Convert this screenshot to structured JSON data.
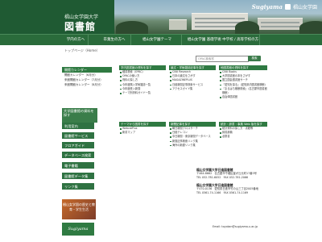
{
  "header": {
    "subtitle": "椙山女学園大学",
    "title": "図書館",
    "brand": "Sugiyama",
    "brand_sub": "椙山女学園"
  },
  "nav": {
    "items": [
      {
        "label": "学内の方へ"
      },
      {
        "label": "卒業生の方へ"
      },
      {
        "label": "椙山女学園テーマ"
      },
      {
        "label": "椙山女学園 基礎学術 中学校 / 高等学校の方へ"
      }
    ]
  },
  "breadcrumb": {
    "text": "トップページ（Home）"
  },
  "search": {
    "placeholder": "OPAC検索窓",
    "button_label": "検索"
  },
  "sidebar": {
    "calendar_title": "開館カレンダー",
    "calendar_items": [
      "開館カレンダー（6月分）",
      "来館開館カレンダー（7月分）",
      "来館開館カレンダー（8月分）"
    ],
    "box_text": "大学図書館の資料を探す",
    "menu_items": [
      "利用案内",
      "図書館サービス",
      "フロアガイド",
      "データベース検索",
      "電子書籍",
      "図書館データ集",
      "リンク集"
    ],
    "banner_text": "椙山女学園の歴史と教育・学生生活",
    "banner2_text": "Sugiyama"
  },
  "blocks": [
    {
      "title": "学内図書館の資料を探す",
      "items": [
        "蔵書検索（OPAC）",
        "OPACの使い方",
        "資料の探し方",
        "今年度購入学術雑誌一覧",
        "今年度受入新聞",
        "テーマ別資料ガイド一覧"
      ]
    },
    {
      "title": "論文・学術雑誌記事を探す",
      "items": [
        "CiNii Research",
        "日本の論文をさがす",
        "MAGAZINEPLUS",
        "日経新聞記事検索サービス",
        "アクセスガイド集"
      ]
    },
    {
      "title": "他図書館の資料を探す",
      "items": [
        "CiNii Books",
        "大学図書館の本をさがす",
        "国立国会図書館サーチ",
        "『愛知を探る』（愛知県内図書館横断）",
        "『まるはち横断検索』（名古屋市図書館横断）",
        "自治体図書館"
      ]
    },
    {
      "title": "テーマから図書を探す",
      "items": [
        "WebcatPlus",
        "新書マップ"
      ]
    },
    {
      "title": "新聞記事を探す",
      "items": [
        "朝日新聞クロスサーチ",
        "日経テレコン",
        "中日新聞・東京新聞データベース",
        "新聞記事検索リンク集",
        "海外の新聞リンク集"
      ]
    },
    {
      "title": "統計・辞書・事典 Web 版を探す",
      "items": [
        "統計資料の探し方・書籍等",
        "辞書辞典",
        "必携書"
      ]
    }
  ],
  "contact": {
    "lib1": "椙山女学園大学日進図書館",
    "addr1": "〒464-8662　名古屋市千種区星が丘元町17番3号",
    "tel1": "TEL 052-781-6052　FAX 052-781-2066",
    "lib2": "椙山女学園大学日進図書館",
    "addr2": "〒470-0136　愛知県日進市竹の山三丁目2005番地",
    "tel2": "TEL 0561-74-1166　FAX 0561-74-1169",
    "email": "Email: toyokan@sugiyama-u.ac.jp"
  }
}
